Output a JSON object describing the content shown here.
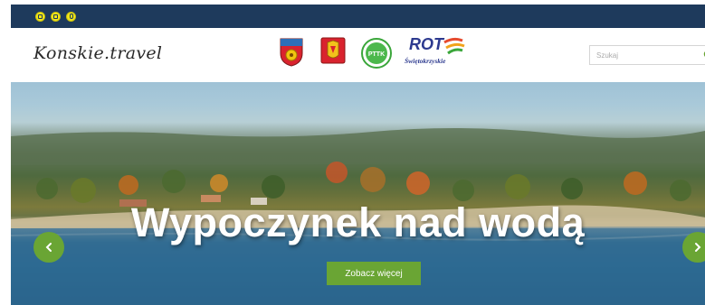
{
  "accessibility": {
    "buttons": [
      {
        "name": "a11y-contrast-button",
        "icon": "contrast-icon"
      },
      {
        "name": "a11y-font-normal-button",
        "icon": "font-size-icon"
      },
      {
        "name": "a11y-font-large-button",
        "icon": "font-size-large-icon"
      }
    ]
  },
  "header": {
    "logo_text": "Konskie.travel",
    "partner_logos": {
      "crest_1": "crest-icon",
      "crest_2": "crest-icon",
      "pttk_text": "PTTK",
      "rot_word": "ROT",
      "rot_sub": "Świętokrzyskie"
    },
    "search": {
      "placeholder": "Szukaj",
      "value": ""
    }
  },
  "slider": {
    "title": "Wypoczynek nad wodą",
    "cta_label": "Zobacz więcej",
    "prev_icon": "chevron-left-icon",
    "next_icon": "chevron-right-icon"
  },
  "colors": {
    "topbar": "#1e3a5c",
    "accent_green": "#6aa534",
    "a11y_yellow": "#f2e619",
    "rot_blue": "#2d3a8f"
  }
}
